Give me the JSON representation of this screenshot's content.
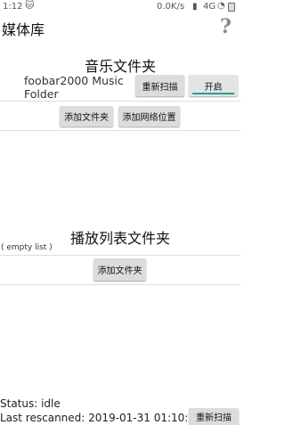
{
  "status_bar": {
    "time": "1:12",
    "speed": "0.0K/s",
    "network": "4G",
    "icons": {
      "cat": "cat-icon",
      "signal": "signal-icon",
      "wifi": "wifi-icon",
      "battery": "battery-icon"
    }
  },
  "app_bar": {
    "title": "媒体库",
    "help_icon": "?"
  },
  "music_section": {
    "title": "音乐文件夹",
    "folder": {
      "name": "foobar2000 Music Folder",
      "rescan_label": "重新扫描",
      "toggle_label": "开启"
    },
    "add_folder_label": "添加文件夹",
    "add_network_label": "添加网络位置"
  },
  "playlist_section": {
    "title": "播放列表文件夹",
    "empty_text": "( empty list )",
    "add_folder_label": "添加文件夹"
  },
  "footer": {
    "status": "Status: idle",
    "last_rescanned": "Last rescanned: 2019-01-31 01:10:02",
    "rescan_label": "重新扫描"
  },
  "colors": {
    "accent": "#2a9d8f",
    "button_bg": "#dcdcdc"
  }
}
